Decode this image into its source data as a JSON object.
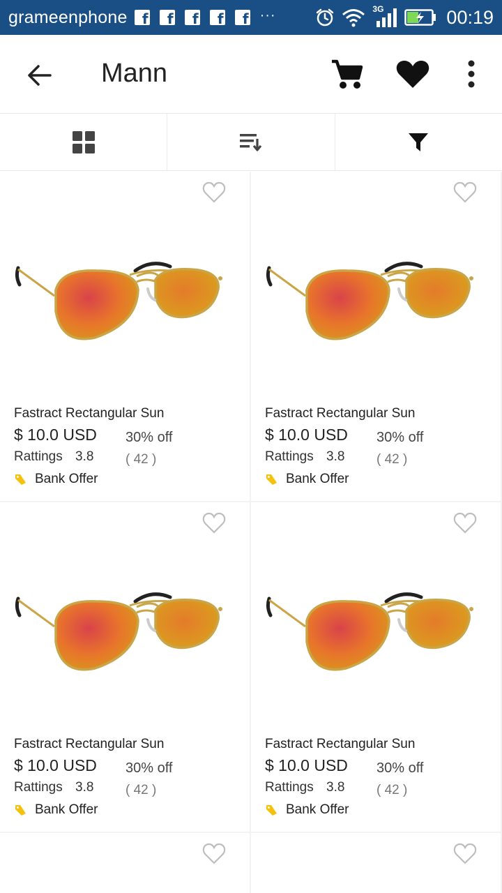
{
  "status_bar": {
    "carrier": "grameenphone",
    "dots": "···",
    "network": "3G",
    "time": "00:19"
  },
  "toolbar": {
    "title": "Mann"
  },
  "products": [
    {
      "name": "Fastract Rectangular Sun",
      "price": "$ 10.0 USD",
      "discount": "30% off",
      "rating_label": "Rattings",
      "rating": "3.8",
      "count": "( 42 )",
      "offer": "Bank Offer"
    },
    {
      "name": "Fastract Rectangular Sun",
      "price": "$ 10.0 USD",
      "discount": "30% off",
      "rating_label": "Rattings",
      "rating": "3.8",
      "count": "( 42 )",
      "offer": "Bank Offer"
    },
    {
      "name": "Fastract Rectangular Sun",
      "price": "$ 10.0 USD",
      "discount": "30% off",
      "rating_label": "Rattings",
      "rating": "3.8",
      "count": "( 42 )",
      "offer": "Bank Offer"
    },
    {
      "name": "Fastract Rectangular Sun",
      "price": "$ 10.0 USD",
      "discount": "30% off",
      "rating_label": "Rattings",
      "rating": "3.8",
      "count": "( 42 )",
      "offer": "Bank Offer"
    }
  ],
  "colors": {
    "status_bar": "#1a4f86",
    "lens": "#e8752a",
    "frame": "#c9a548",
    "tag": "#f4c20d"
  }
}
